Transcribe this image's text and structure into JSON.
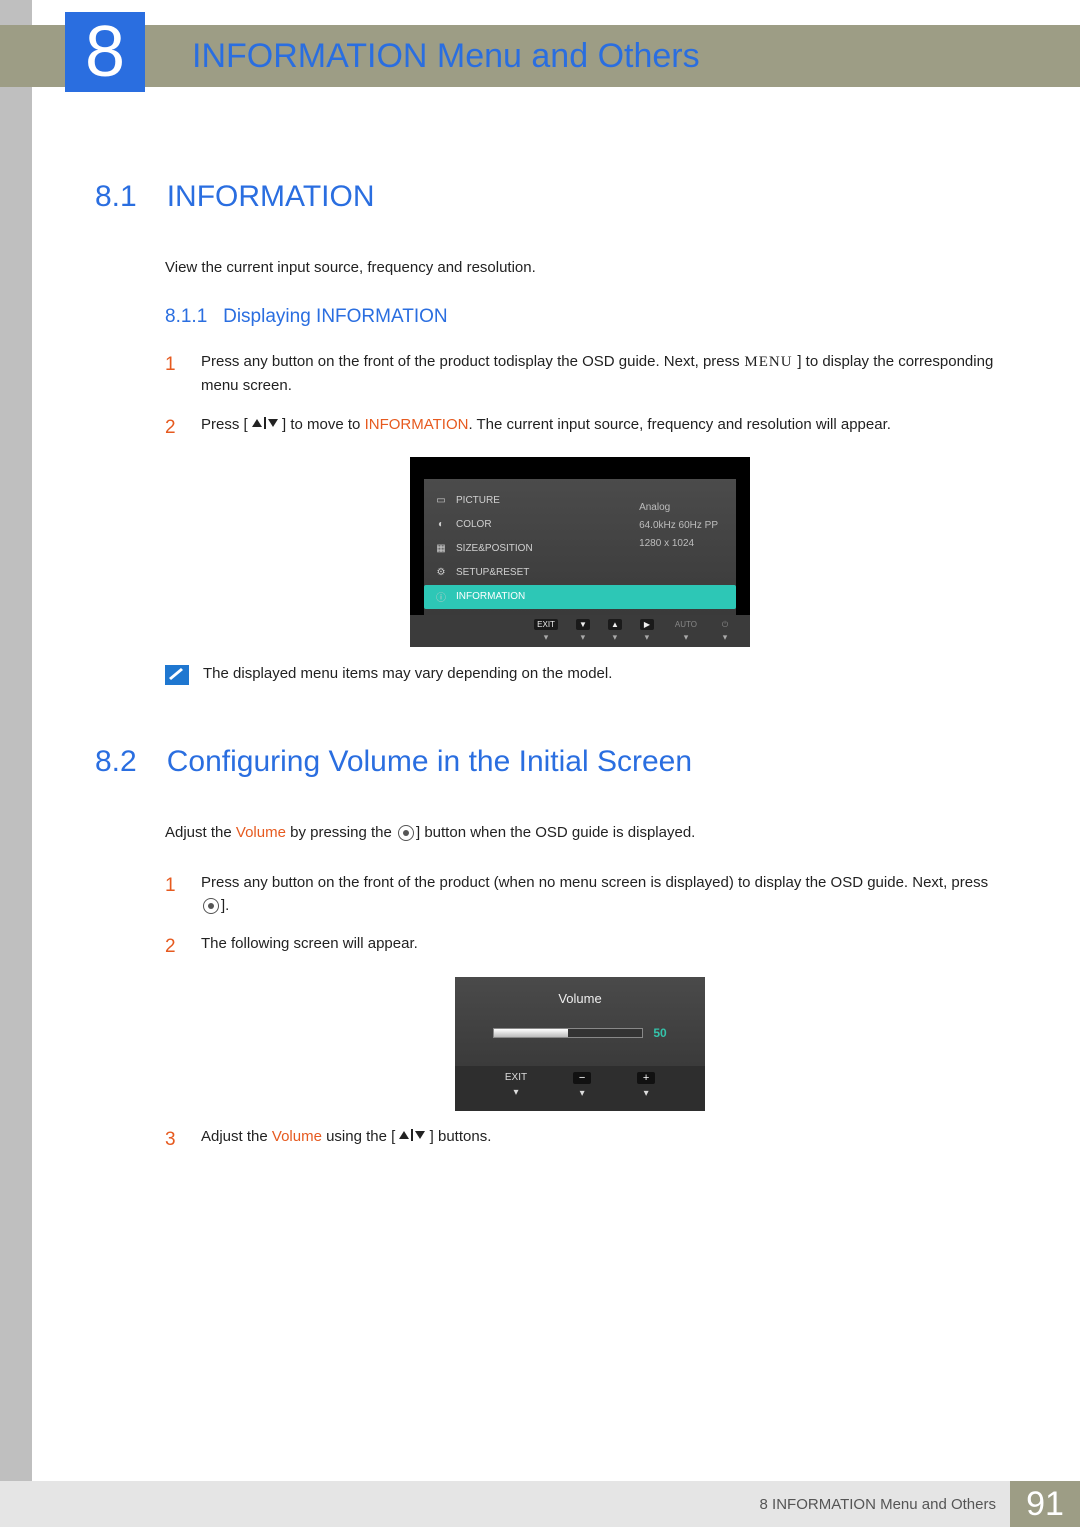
{
  "chapter": {
    "number": "8",
    "title": "INFORMATION Menu and Others"
  },
  "section1": {
    "num": "8.1",
    "title": "INFORMATION",
    "intro": "View the current input source, frequency and resolution.",
    "sub": {
      "num": "8.1.1",
      "title": "Displaying INFORMATION"
    },
    "step1": {
      "num": "1",
      "t1": "Press any button on the front of the product to",
      "t2": "display the OSD guide. Next, press",
      "menu": " MENU ",
      "t3": "] to display the corresponding menu screen."
    },
    "step2": {
      "num": "2",
      "t1": "Press [",
      "t2": "] to move to",
      "kw": " INFORMATION",
      "t3": ". The current input source, frequency and resolution will appear."
    },
    "osd": {
      "items": [
        "PICTURE",
        "COLOR",
        "SIZE&POSITION",
        "SETUP&RESET",
        "INFORMATION"
      ],
      "values": [
        "Analog",
        "64.0kHz 60Hz PP",
        "1280 x 1024"
      ],
      "nav": [
        "EXIT",
        "▼",
        "▲",
        "▶",
        "AUTO",
        "⏻"
      ]
    },
    "note": "The displayed menu items may vary depending on the model."
  },
  "section2": {
    "num": "8.2",
    "title": "Configuring Volume in the Initial Screen",
    "introA": "Adjust the ",
    "introKW": "Volume",
    "introB": " by pressing the ",
    "introC": "] button when the OSD guide is displayed.",
    "step1": {
      "num": "1",
      "t1": "Press any button on the front of the product (when",
      "t2": " no menu screen is displayed) to display the OSD guide. Next, press ",
      "t3": "]."
    },
    "step2": {
      "num": "2",
      "text": "The following screen will appear."
    },
    "vol": {
      "title": "Volume",
      "value": "50",
      "nav": [
        "EXIT",
        "−",
        "+"
      ]
    },
    "step3": {
      "num": "3",
      "t1": "Adjust the",
      "kw": " Volume ",
      "t2": " using the [",
      "t3": "] buttons."
    }
  },
  "footer": {
    "chapterRef": "8 INFORMATION Menu and Others",
    "page": "91"
  }
}
